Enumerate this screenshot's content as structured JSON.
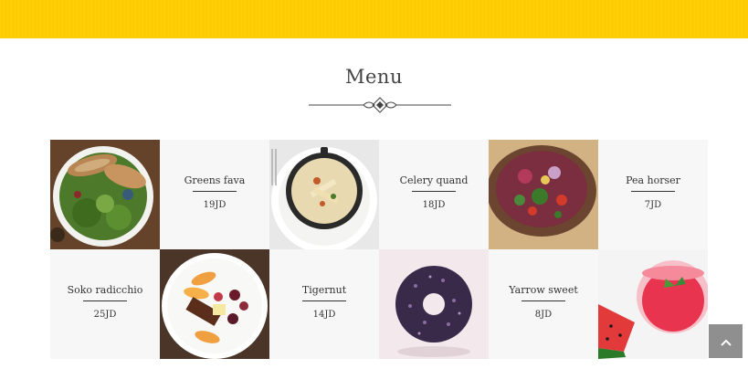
{
  "menu": {
    "title": "Menu",
    "items": [
      {
        "name": "Greens fava",
        "price": "19JD"
      },
      {
        "name": "Celery quand",
        "price": "18JD"
      },
      {
        "name": "Pea horser",
        "price": "7JD"
      },
      {
        "name": "Soko radicchio",
        "price": "25JD"
      },
      {
        "name": "Tigernut",
        "price": "14JD"
      },
      {
        "name": "Yarrow sweet",
        "price": "8JD"
      }
    ]
  },
  "icons": {
    "scroll_top": "chevron-up-icon",
    "divider": "ornament-divider-icon"
  },
  "colors": {
    "header": "#ffcc00",
    "cell_bg": "#f7f7f7",
    "scroll_button": "#8f8f8f"
  }
}
